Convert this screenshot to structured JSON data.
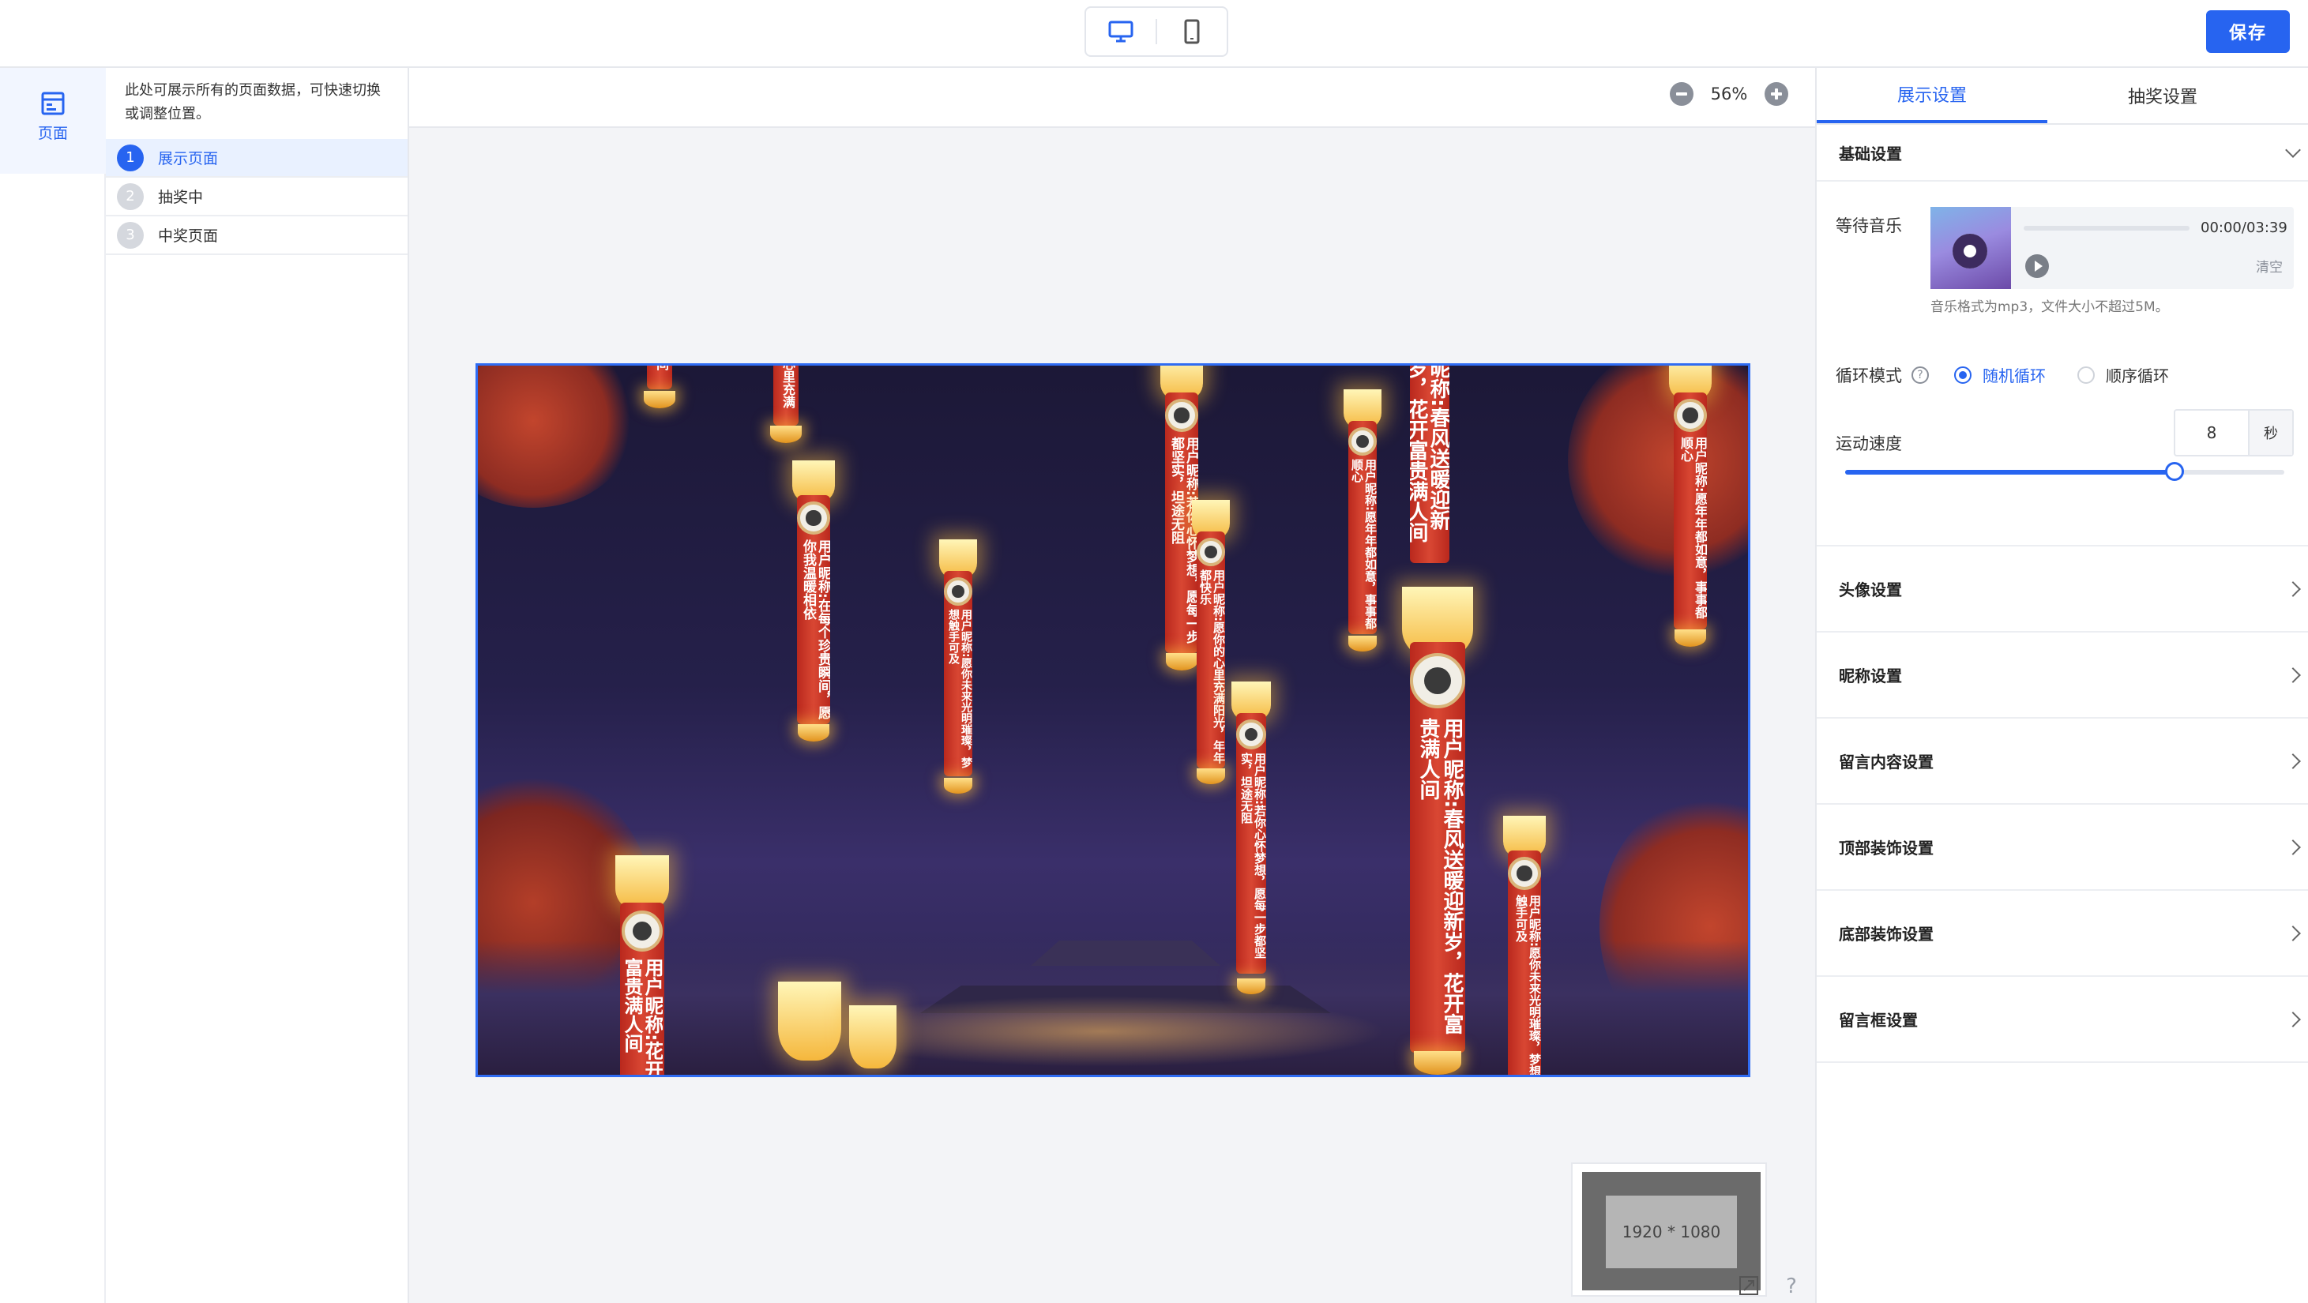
{
  "toolbar": {
    "save_label": "保存",
    "device_desktop_icon": "monitor-icon",
    "device_mobile_icon": "phone-icon"
  },
  "rail": {
    "label": "页面",
    "icon": "page-icon"
  },
  "pages": {
    "description": "此处可展示所有的页面数据，可快速切换或调整位置。",
    "items": [
      {
        "num": "1",
        "label": "展示页面",
        "active": true
      },
      {
        "num": "2",
        "label": "抽奖中",
        "active": false
      },
      {
        "num": "3",
        "label": "中奖页面",
        "active": false
      }
    ]
  },
  "canvas": {
    "zoom_label": "56%",
    "minimap_label": "1920 * 1080",
    "help_label": "?",
    "stage_texts": {
      "l1": "用户昵称:花开富贵满人间",
      "l2": "用户昵称:在每个珍贵瞬间，愿你我温暖相依",
      "l3": "用户昵称:愿你未来光明璀璨，梦想触手可及",
      "l4": "用户昵称:若你心怀梦想，愿每一步都坚实，坦途无阻",
      "l5": "用户昵称:愿你的心里充满阳光，年年都快乐",
      "l6": "用户昵称:若你心怀梦想，愿每一步都坚实，坦途无阻",
      "l7": "用户昵称:愿年年都如意，事事都顺心",
      "l8": "用户昵称:春风送暖迎新岁，花开富贵满人间",
      "l9": "用户昵称:愿你未来光明璀璨，梦想触手可及",
      "l10": "用户昵称:愿年年都如意，事事都顺心",
      "l11": "心里充满",
      "l12": "昵称:春风送暖迎新岁，花开富贵满人间",
      "l13": "间"
    }
  },
  "settings": {
    "tabs": [
      "展示设置",
      "抽奖设置"
    ],
    "active_tab": 0,
    "basic_title": "基础设置",
    "music_label": "等待音乐",
    "music_time": "00:00/03:39",
    "music_clear": "清空",
    "music_hint": "音乐格式为mp3，文件大小不超过5M。",
    "loop_label": "循环模式",
    "loop_options": [
      "随机循环",
      "顺序循环"
    ],
    "loop_selected": 0,
    "speed_label": "运动速度",
    "speed_value": "8",
    "speed_unit": "秒",
    "speed_slider_fraction": 0.75,
    "sections": [
      "头像设置",
      "昵称设置",
      "留言内容设置",
      "顶部装饰设置",
      "底部装饰设置",
      "留言框设置"
    ]
  },
  "colors": {
    "accent": "#2764f0",
    "lantern_red": "#c93524",
    "lantern_glow": "#f5b73c",
    "sky_dark": "#1c1837"
  }
}
